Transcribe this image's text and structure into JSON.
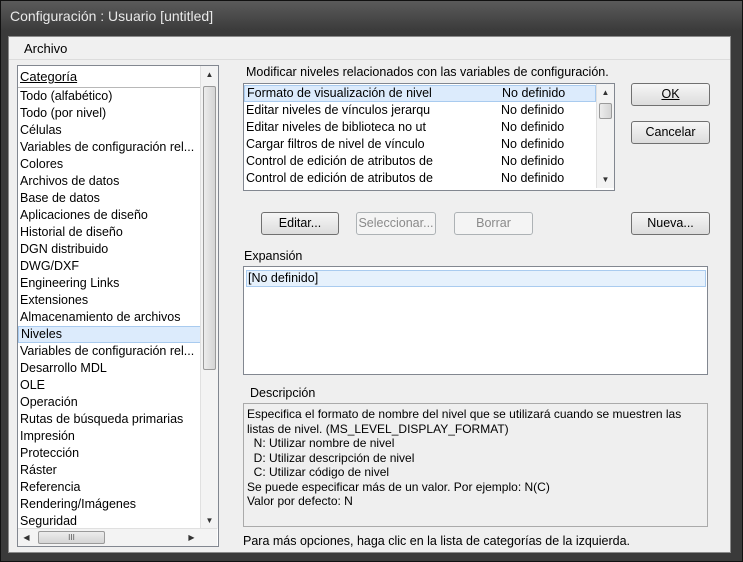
{
  "window": {
    "title": "Configuración : Usuario [untitled]"
  },
  "menu": {
    "archivo": "Archivo"
  },
  "category": {
    "header": "Categoría",
    "items": [
      "Todo (alfabético)",
      "Todo (por nivel)",
      "Células",
      "Variables de configuración rel...",
      "Colores",
      "Archivos de datos",
      "Base de datos",
      "Aplicaciones de diseño",
      "Historial de diseño",
      "DGN distribuido",
      "DWG/DXF",
      "Engineering Links",
      "Extensiones",
      "Almacenamiento de archivos",
      "Niveles",
      "Variables de configuración rel...",
      "Desarrollo MDL",
      "OLE",
      "Operación",
      "Rutas de búsqueda primarias",
      "Impresión",
      "Protección",
      "Ráster",
      "Referencia",
      "Rendering/Imágenes",
      "Seguridad"
    ],
    "selected_index": 14,
    "hscroll_grip": "III"
  },
  "levels": {
    "caption": "Modificar niveles relacionados con las variables de configuración.",
    "rows": [
      {
        "name": "Formato de visualización de nivel",
        "value": "No definido"
      },
      {
        "name": "Editar niveles de vínculos jerarqu",
        "value": "No definido"
      },
      {
        "name": "Editar niveles de biblioteca no ut",
        "value": "No definido"
      },
      {
        "name": "Cargar filtros de nivel de vínculo",
        "value": "No definido"
      },
      {
        "name": "Control de edición de atributos de",
        "value": "No definido"
      },
      {
        "name": "Control de edición de atributos de",
        "value": "No definido"
      }
    ]
  },
  "buttons": {
    "ok": "OK",
    "cancel": "Cancelar",
    "edit": "Editar...",
    "select": "Seleccionar...",
    "delete": "Borrar",
    "new": "Nueva..."
  },
  "expansion": {
    "label": "Expansión",
    "value": "[No definido]"
  },
  "description": {
    "label": "Descripción",
    "text": "Especifica el formato de nombre del nivel que se utilizará cuando se muestren las\nlistas de nivel. (MS_LEVEL_DISPLAY_FORMAT)\n  N: Utilizar nombre de nivel\n  D: Utilizar descripción de nivel\n  C: Utilizar código de nivel\nSe puede especificar más de un valor. Por ejemplo: N(C)\nValor por defecto: N"
  },
  "footer": {
    "hint": "Para más opciones, haga clic en la lista de categorías de la izquierda."
  }
}
